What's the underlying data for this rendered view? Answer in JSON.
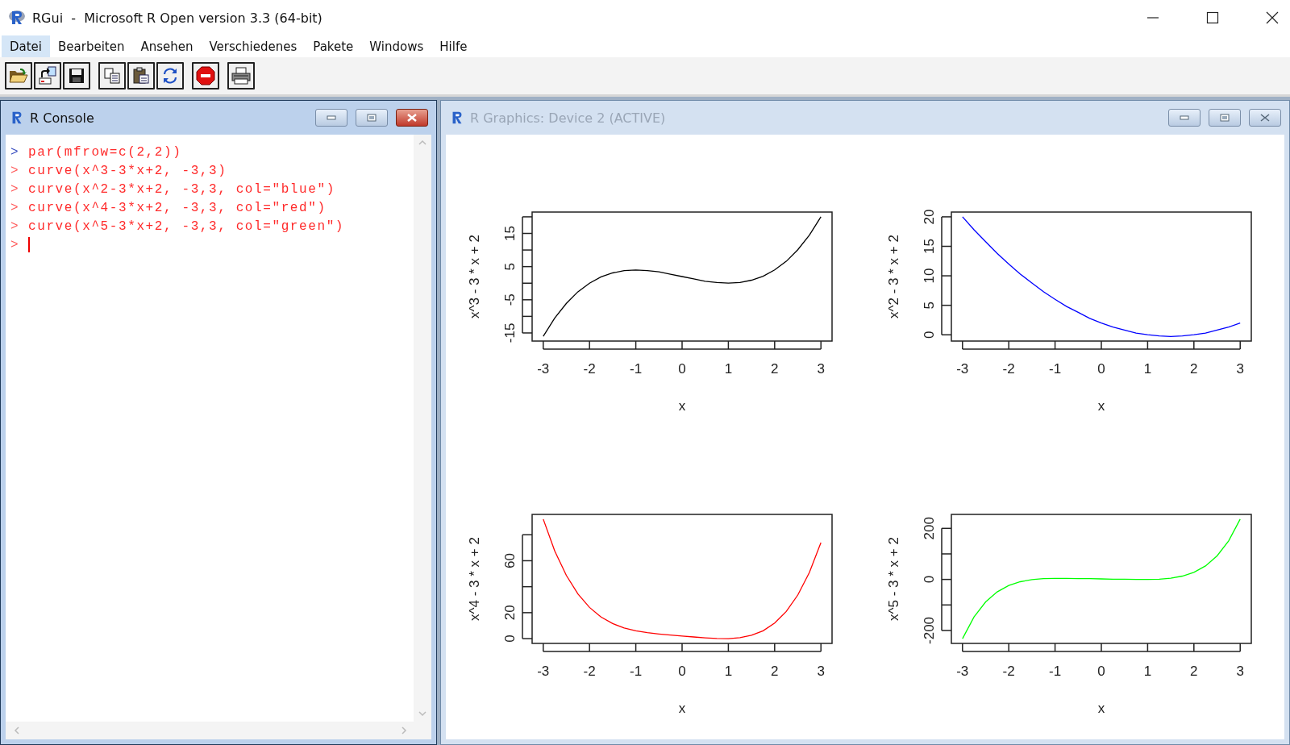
{
  "window": {
    "title": "RGui  -  Microsoft R Open version 3.3 (64-bit)"
  },
  "menu": [
    {
      "label": "Datei",
      "selected": true
    },
    {
      "label": "Bearbeiten",
      "selected": false
    },
    {
      "label": "Ansehen",
      "selected": false
    },
    {
      "label": "Verschiedenes",
      "selected": false
    },
    {
      "label": "Pakete",
      "selected": false
    },
    {
      "label": "Windows",
      "selected": false
    },
    {
      "label": "Hilfe",
      "selected": false
    }
  ],
  "toolbar_groups": [
    {
      "buttons": [
        {
          "kind": "open"
        },
        {
          "kind": "load"
        },
        {
          "kind": "save"
        }
      ]
    },
    {
      "buttons": [
        {
          "kind": "copy"
        },
        {
          "kind": "paste"
        },
        {
          "kind": "refresh"
        }
      ]
    },
    {
      "buttons": [
        {
          "kind": "stop"
        }
      ]
    },
    {
      "buttons": [
        {
          "kind": "print"
        }
      ]
    }
  ],
  "console": {
    "title": "R Console",
    "active": true,
    "lines": [
      {
        "prompt": ">",
        "color": "#3a4fc0",
        "code": "par(mfrow=c(2,2))"
      },
      {
        "prompt": ">",
        "color": "#ff5a5a",
        "code": "curve(x^3-3*x+2, -3,3)"
      },
      {
        "prompt": ">",
        "color": "#ff5a5a",
        "code": "curve(x^2-3*x+2, -3,3, col=\"blue\")"
      },
      {
        "prompt": ">",
        "color": "#ff5a5a",
        "code": "curve(x^4-3*x+2, -3,3, col=\"red\")"
      },
      {
        "prompt": ">",
        "color": "#ff5a5a",
        "code": "curve(x^5-3*x+2, -3,3, col=\"green\")"
      }
    ],
    "input_prompt": ">"
  },
  "graphics": {
    "title": "R Graphics: Device 2 (ACTIVE)",
    "active": false,
    "plots": [
      {
        "chart_data": {
          "type": "line",
          "xlabel": "x",
          "ylabel": "x^3 - 3 * x + 2",
          "xlim": [
            -3.24,
            3.24
          ],
          "ylim": [
            -17.44,
            21.44
          ],
          "xticks": [
            -3,
            -2,
            -1,
            0,
            1,
            2,
            3
          ],
          "yticks": [
            -15,
            -5,
            5,
            15
          ],
          "x": [
            -3,
            -2.75,
            -2.5,
            -2.25,
            -2,
            -1.75,
            -1.5,
            -1.25,
            -1,
            -0.75,
            -0.5,
            -0.25,
            0,
            0.25,
            0.5,
            0.75,
            1,
            1.25,
            1.5,
            1.75,
            2,
            2.25,
            2.5,
            2.75,
            3
          ],
          "series": [
            {
              "color": "#000000",
              "values": [
                -16,
                -10.5,
                -6.1,
                -2.6,
                0,
                1.9,
                3.1,
                3.8,
                4,
                3.8,
                3.4,
                2.7,
                2,
                1.3,
                0.6,
                0.2,
                0,
                0.2,
                0.9,
                2.1,
                4,
                6.6,
                10.1,
                14.5,
                20
              ]
            }
          ]
        }
      },
      {
        "chart_data": {
          "type": "line",
          "xlabel": "x",
          "ylabel": "x^2 - 3 * x + 2",
          "xlim": [
            -3.24,
            3.24
          ],
          "ylim": [
            -1.06,
            20.81
          ],
          "xticks": [
            -3,
            -2,
            -1,
            0,
            1,
            2,
            3
          ],
          "yticks": [
            0,
            5,
            10,
            15,
            20
          ],
          "x": [
            -3,
            -2.75,
            -2.5,
            -2.25,
            -2,
            -1.75,
            -1.5,
            -1.25,
            -1,
            -0.75,
            -0.5,
            -0.25,
            0,
            0.25,
            0.5,
            0.75,
            1,
            1.25,
            1.5,
            1.75,
            2,
            2.25,
            2.5,
            2.75,
            3
          ],
          "series": [
            {
              "color": "#0000ff",
              "values": [
                20,
                17.8,
                15.8,
                13.8,
                12,
                10.3,
                8.8,
                7.3,
                6,
                4.8,
                3.8,
                2.8,
                2,
                1.3,
                0.8,
                0.3,
                0,
                -0.2,
                -0.3,
                -0.2,
                0,
                0.3,
                0.8,
                1.3,
                2
              ]
            }
          ]
        }
      },
      {
        "chart_data": {
          "type": "line",
          "xlabel": "x",
          "ylabel": "x^4 - 3 * x + 2",
          "xlim": [
            -3.24,
            3.24
          ],
          "ylim": [
            -3.68,
            95.68
          ],
          "xticks": [
            -3,
            -2,
            -1,
            0,
            1,
            2,
            3
          ],
          "yticks": [
            0,
            20,
            60
          ],
          "x": [
            -3,
            -2.75,
            -2.5,
            -2.25,
            -2,
            -1.75,
            -1.5,
            -1.25,
            -1,
            -0.75,
            -0.5,
            -0.25,
            0,
            0.25,
            0.5,
            0.75,
            1,
            1.25,
            1.5,
            1.75,
            2,
            2.25,
            2.5,
            2.75,
            3
          ],
          "series": [
            {
              "color": "#ff0000",
              "values": [
                92,
                67.4,
                48.6,
                34.4,
                24,
                16.6,
                11.6,
                8.2,
                6,
                4.6,
                3.6,
                2.8,
                2,
                1.3,
                0.6,
                0.1,
                0,
                0.7,
                2.6,
                6.1,
                12,
                20.9,
                33.6,
                50.9,
                74
              ]
            }
          ]
        }
      },
      {
        "chart_data": {
          "type": "line",
          "xlabel": "x",
          "ylabel": "x^5 - 3 * x + 2",
          "xlim": [
            -3.24,
            3.24
          ],
          "ylim": [
            -250.72,
            254.72
          ],
          "xticks": [
            -3,
            -2,
            -1,
            0,
            1,
            2,
            3
          ],
          "yticks": [
            -200,
            0,
            200
          ],
          "x": [
            -3,
            -2.75,
            -2.5,
            -2.25,
            -2,
            -1.75,
            -1.5,
            -1.25,
            -1,
            -0.75,
            -0.5,
            -0.25,
            0,
            0.25,
            0.5,
            0.75,
            1,
            1.25,
            1.5,
            1.75,
            2,
            2.25,
            2.5,
            2.75,
            3
          ],
          "series": [
            {
              "color": "#00ff00",
              "values": [
                -232,
                -147,
                -88,
                -49,
                -24,
                -9,
                -1,
                3,
                4,
                4,
                3,
                3,
                2,
                1,
                1,
                0,
                0,
                1,
                5,
                13,
                28,
                53,
                92,
                151,
                236
              ]
            }
          ]
        }
      }
    ]
  }
}
